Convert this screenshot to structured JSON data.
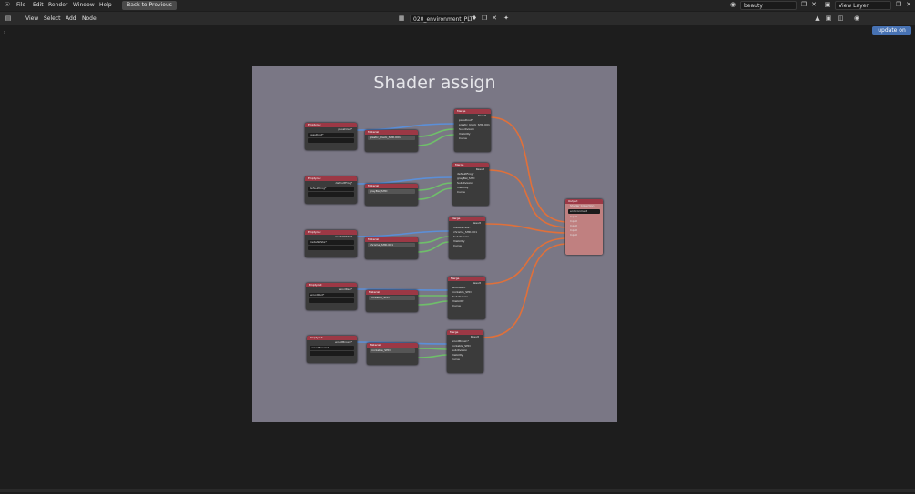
{
  "menubar": {
    "items": [
      "File",
      "Edit",
      "Render",
      "Window",
      "Help"
    ],
    "back_label": "Back to Previous",
    "scene": "beauty",
    "view_layer": "View Layer"
  },
  "editor_header": {
    "menus": [
      "View",
      "Select",
      "Add",
      "Node"
    ],
    "tree_name": "020_environment_PLT",
    "update_label": "update on"
  },
  "frame": {
    "title": "Shader assign"
  },
  "groups": [
    {
      "empty_label": "Emptyout",
      "empty_out": "passDout*",
      "empty_field": "passDout*",
      "material_label": "Material",
      "material": "plastic_black_SHD.001",
      "merge_label": "Merge",
      "merge_in": "passDout*",
      "merge_mat": "plastic_black_SHD.001"
    },
    {
      "empty_label": "Emptyout",
      "empty_out": "defaultFrog*",
      "empty_field": "defaultFrog*",
      "material_label": "Material",
      "material": "greyBal_SHD",
      "merge_label": "Merge",
      "merge_in": "defaultFrog*",
      "merge_mat": "greyBal_SHD"
    },
    {
      "empty_label": "Emptyout",
      "empty_out": "metalWhite*",
      "empty_field": "metalWhite*",
      "material_label": "Material",
      "material": "chrome_SHD.001",
      "merge_label": "Merge",
      "merge_in": "metalWhite*",
      "merge_mat": "chrome_SHD.001"
    },
    {
      "empty_label": "Emptyout",
      "empty_out": "woodRed*",
      "empty_field": "woodRed*",
      "material_label": "Material",
      "material": "rockable_SHD",
      "merge_label": "Merge",
      "merge_in": "woodRed*",
      "merge_mat": "rockable_SHD"
    },
    {
      "empty_label": "Emptyout",
      "empty_out": "woodBrown*",
      "empty_field": "woodBrown*",
      "material_label": "Material",
      "material": "rockable_SHD",
      "merge_label": "Merge",
      "merge_in": "woodBrown*",
      "merge_mat": "rockable_SHD"
    }
  ],
  "merge_rows": {
    "result": "Result",
    "shader": "Subdivision",
    "visibility": "Visibility",
    "curve": "Curve"
  },
  "output": {
    "label": "Output",
    "field_label": "Shader Collection",
    "field": "environment",
    "inputs": [
      "Input",
      "Input",
      "Input",
      "Input",
      "Input"
    ]
  },
  "colors": {
    "link_orange": "#e0703a",
    "link_blue": "#5b8fd8",
    "link_green": "#6fbf6a",
    "node_red": "#9c3845",
    "accent": "#4772b3"
  }
}
